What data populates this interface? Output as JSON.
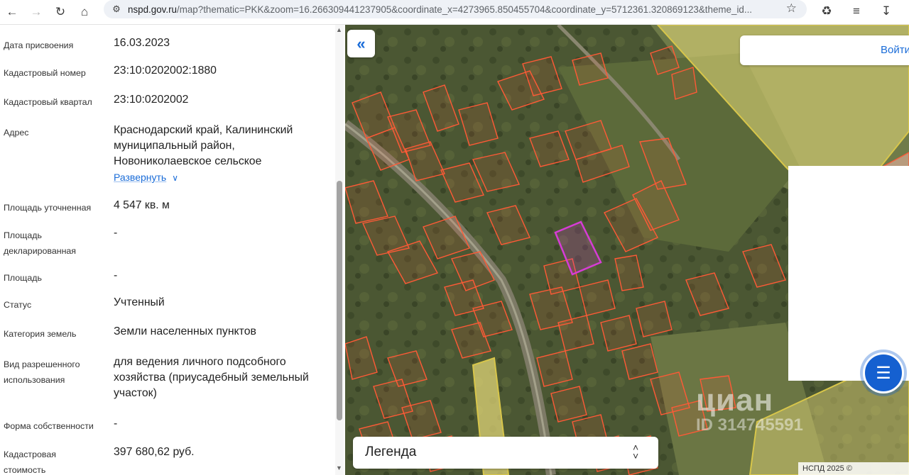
{
  "browser": {
    "url_host": "nspd.gov.ru",
    "url_rest": "/map?thematic=PKK&zoom=16.266309441237905&coordinate_x=4273965.850455704&coordinate_y=5712361.320869123&theme_id..."
  },
  "info": {
    "rows": [
      {
        "label": "Дата присвоения",
        "value": "16.03.2023"
      },
      {
        "label": "Кадастровый номер",
        "value": "23:10:0202002:1880"
      },
      {
        "label": "Кадастровый квартал",
        "value": "23:10:0202002"
      },
      {
        "label": "Адрес",
        "value_lines": [
          "Краснодарский край, Калининский",
          "муниципальный район,",
          "Новониколаевское сельское"
        ],
        "expand": "Развернуть"
      },
      {
        "label": "Площадь уточненная",
        "value": "4 547 кв. м"
      },
      {
        "label_lines": [
          "Площадь",
          "декларированная"
        ],
        "value": "-"
      },
      {
        "label": "Площадь",
        "value": "-"
      },
      {
        "label": "Статус",
        "value": "Учтенный"
      },
      {
        "label": "Категория земель",
        "value": "Земли населенных пунктов"
      },
      {
        "label_lines": [
          "Вид разрешенного",
          "использования"
        ],
        "value_lines": [
          "для ведения личного подсобного",
          "хозяйства (приусадебный земельный",
          "участок)"
        ]
      },
      {
        "label": "Форма собственности",
        "value": "-"
      },
      {
        "label_lines": [
          "Кадастровая",
          "стоимость"
        ],
        "value": "397 680,62 руб."
      }
    ]
  },
  "map": {
    "search_button": "Войти",
    "legend_label": "Легенда",
    "watermark": "циан",
    "watermark_id": "ID 314745591",
    "copyright": "НСПД 2025 ©",
    "parcel_color": "#ff5a36",
    "selected_color": "#d63cd6",
    "zone_color": "#e8dc7a"
  },
  "icons": {
    "back": "arrow-left-icon",
    "forward": "arrow-right-icon",
    "reload": "reload-icon",
    "home": "home-icon",
    "site": "tune-icon",
    "bookmark": "star-icon",
    "extensions": "puzzle-icon",
    "readlist": "list-icon",
    "download": "download-icon",
    "menu": "more-icon",
    "collapse": "double-chevron-left-icon",
    "chat": "chat-icon",
    "legend_toggle": "up-down-chevron-icon"
  }
}
